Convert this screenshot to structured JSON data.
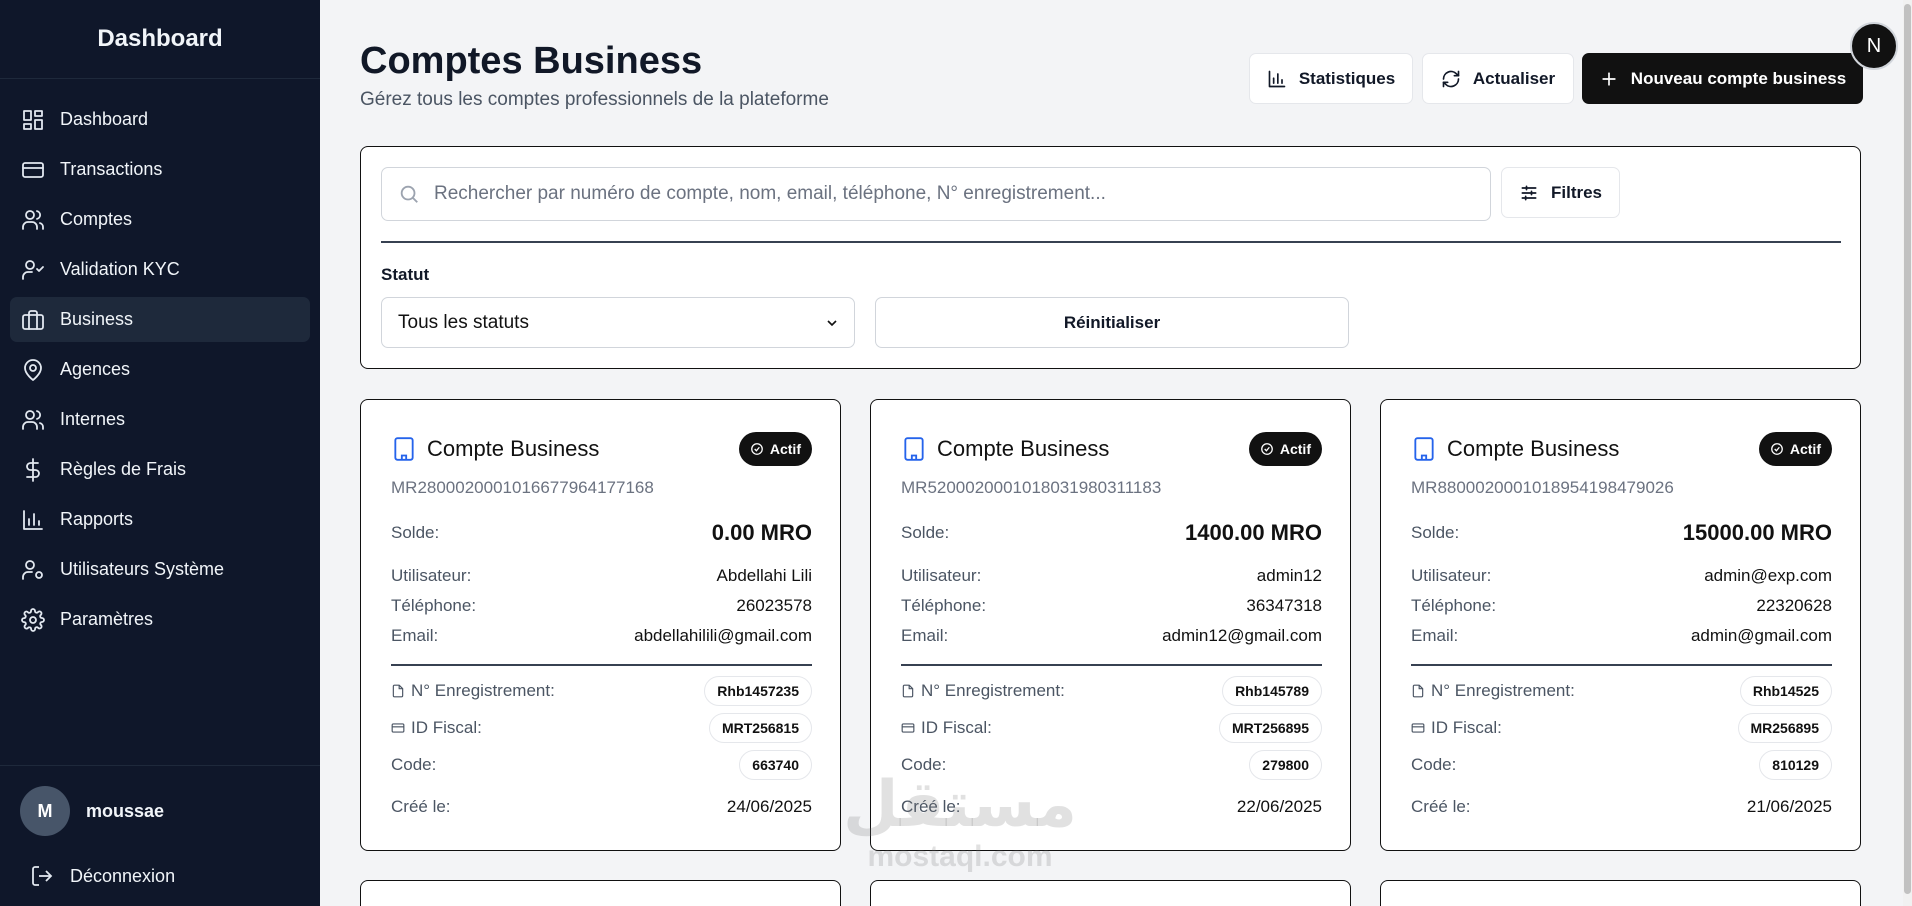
{
  "sidebar": {
    "title": "Dashboard",
    "items": [
      {
        "label": "Dashboard",
        "icon": "dashboard-icon"
      },
      {
        "label": "Transactions",
        "icon": "credit-card-icon"
      },
      {
        "label": "Comptes",
        "icon": "users-icon"
      },
      {
        "label": "Validation KYC",
        "icon": "user-check-icon"
      },
      {
        "label": "Business",
        "icon": "briefcase-icon"
      },
      {
        "label": "Agences",
        "icon": "map-pin-icon"
      },
      {
        "label": "Internes",
        "icon": "users-icon"
      },
      {
        "label": "Règles de Frais",
        "icon": "dollar-icon"
      },
      {
        "label": "Rapports",
        "icon": "bar-chart-icon"
      },
      {
        "label": "Utilisateurs Système",
        "icon": "user-cog-icon"
      },
      {
        "label": "Paramètres",
        "icon": "gear-icon"
      }
    ],
    "active_index": 4,
    "user": {
      "initial": "M",
      "name": "moussae"
    },
    "logout_label": "Déconnexion"
  },
  "header": {
    "title": "Comptes Business",
    "subtitle": "Gérez tous les comptes professionnels de la plateforme",
    "stats_label": "Statistiques",
    "refresh_label": "Actualiser",
    "new_label": "Nouveau compte business",
    "corner_initial": "N"
  },
  "filters": {
    "search_placeholder": "Rechercher par numéro de compte, nom, email, téléphone, N° enregistrement...",
    "filters_label": "Filtres",
    "status_label": "Statut",
    "status_value": "Tous les statuts",
    "reset_label": "Réinitialiser"
  },
  "labels": {
    "card_title": "Compte Business",
    "balance": "Solde:",
    "user": "Utilisateur:",
    "phone": "Téléphone:",
    "email": "Email:",
    "registration": "N° Enregistrement:",
    "fiscal": "ID Fiscal:",
    "code": "Code:",
    "created": "Créé le:"
  },
  "cards": [
    {
      "status": "Actif",
      "account": "MR2800020001016677964177168",
      "balance": "0.00 MRO",
      "user": "Abdellahi Lili",
      "phone": "26023578",
      "email": "abdellahilili@gmail.com",
      "registration": "Rhb1457235",
      "fiscal": "MRT256815",
      "code": "663740",
      "created": "24/06/2025"
    },
    {
      "status": "Actif",
      "account": "MR5200020001018031980311183",
      "balance": "1400.00 MRO",
      "user": "admin12",
      "phone": "36347318",
      "email": "admin12@gmail.com",
      "registration": "Rhb145789",
      "fiscal": "MRT256895",
      "code": "279800",
      "created": "22/06/2025"
    },
    {
      "status": "Actif",
      "account": "MR8800020001018954198479026",
      "balance": "15000.00 MRO",
      "user": "admin@exp.com",
      "phone": "22320628",
      "email": "admin@gmail.com",
      "registration": "Rhb14525",
      "fiscal": "MR256895",
      "code": "810129",
      "created": "21/06/2025"
    }
  ],
  "watermark": {
    "arabic": "مستقل",
    "latin": "mostaql.com"
  },
  "colors": {
    "sidebar_bg": "#0f172a",
    "accent_icon": "#2563eb",
    "primary_button": "#111111"
  }
}
